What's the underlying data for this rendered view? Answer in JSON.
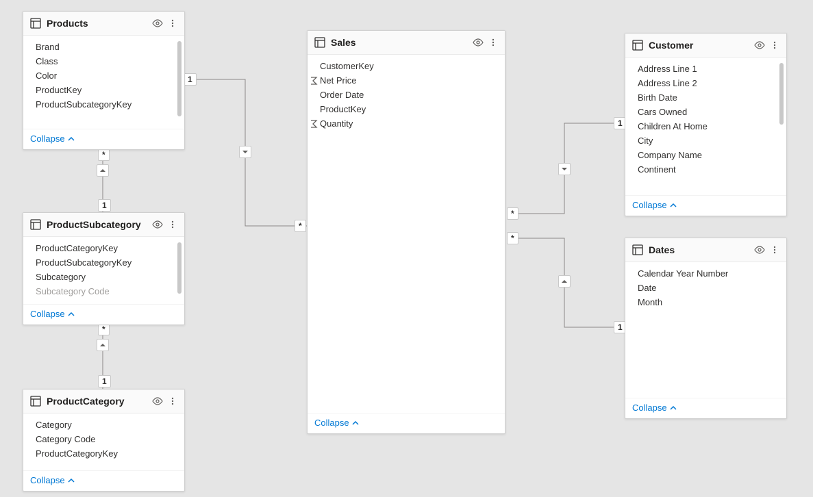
{
  "collapse_label": "Collapse",
  "cardinality": {
    "one": "1",
    "many": "*"
  },
  "tables": {
    "products": {
      "title": "Products",
      "fields": [
        "Brand",
        "Class",
        "Color",
        "ProductKey",
        "ProductSubcategoryKey"
      ]
    },
    "productSubcategory": {
      "title": "ProductSubcategory",
      "fields": [
        "ProductCategoryKey",
        "ProductSubcategoryKey",
        "Subcategory",
        "Subcategory Code"
      ]
    },
    "productCategory": {
      "title": "ProductCategory",
      "fields": [
        "Category",
        "Category Code",
        "ProductCategoryKey"
      ]
    },
    "sales": {
      "title": "Sales",
      "fields": [
        {
          "name": "CustomerKey",
          "agg": false
        },
        {
          "name": "Net Price",
          "agg": true
        },
        {
          "name": "Order Date",
          "agg": false
        },
        {
          "name": "ProductKey",
          "agg": false
        },
        {
          "name": "Quantity",
          "agg": true
        }
      ]
    },
    "customer": {
      "title": "Customer",
      "fields": [
        "Address Line 1",
        "Address Line 2",
        "Birth Date",
        "Cars Owned",
        "Children At Home",
        "City",
        "Company Name",
        "Continent"
      ]
    },
    "dates": {
      "title": "Dates",
      "fields": [
        "Calendar Year Number",
        "Date",
        "Month"
      ]
    }
  },
  "relationships": [
    {
      "from": "Products",
      "to": "Sales",
      "from_card": "1",
      "to_card": "*"
    },
    {
      "from": "ProductSubcategory",
      "to": "Products",
      "from_card": "1",
      "to_card": "*"
    },
    {
      "from": "ProductCategory",
      "to": "ProductSubcategory",
      "from_card": "1",
      "to_card": "*"
    },
    {
      "from": "Customer",
      "to": "Sales",
      "from_card": "1",
      "to_card": "*"
    },
    {
      "from": "Dates",
      "to": "Sales",
      "from_card": "1",
      "to_card": "*"
    }
  ]
}
